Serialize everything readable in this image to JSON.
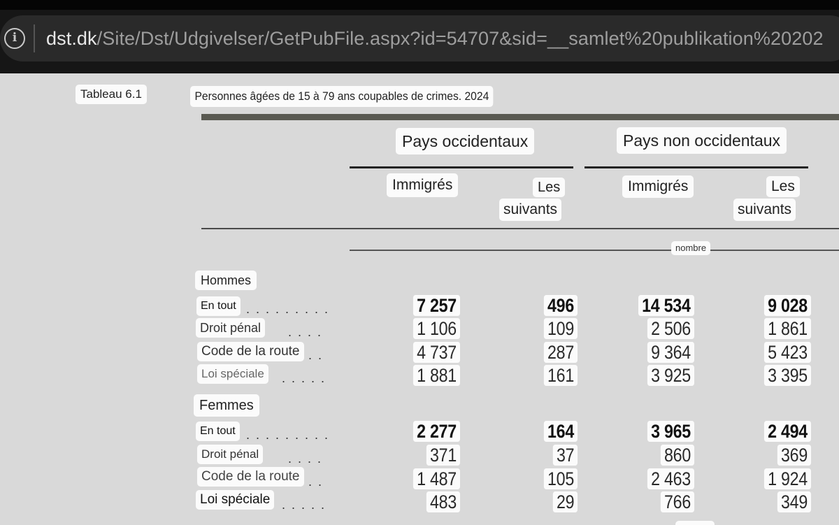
{
  "browser": {
    "url_host": "dst.dk",
    "url_path": "/Site/Dst/Udgivelser/GetPubFile.aspx?id=54707&sid=__samlet%20publikation%20202"
  },
  "table": {
    "label": "Tableau 6.1",
    "title": "Personnes âgées de 15 à 79 ans coupables de crimes. 2024",
    "group_headers": [
      "Pays occidentaux",
      "Pays non occidentaux"
    ],
    "sub_headers": {
      "immigres": "Immigrés",
      "suivants_1": "Les",
      "suivants_2": "suivants"
    },
    "unit": "nombre",
    "sections": [
      {
        "name": "Hommes",
        "rows": [
          {
            "label": "En tout",
            "dots": ". . . . . . . . .",
            "values": [
              "7 257",
              "496",
              "14 534",
              "9 028"
            ],
            "bold": true
          },
          {
            "label": "Droit pénal",
            "dots": ". . . .",
            "values": [
              "1 106",
              "109",
              "2 506",
              "1 861"
            ],
            "bold": false
          },
          {
            "label": "Code de la route",
            "dots": ". .",
            "values": [
              "4 737",
              "287",
              "9 364",
              "5 423"
            ],
            "bold": false
          },
          {
            "label": "Loi spéciale",
            "dots": ". . . . .",
            "values": [
              "1 881",
              "161",
              "3 925",
              "3 395"
            ],
            "bold": false
          }
        ]
      },
      {
        "name": "Femmes",
        "rows": [
          {
            "label": "En tout",
            "dots": ". . . . . . . . .",
            "values": [
              "2 277",
              "164",
              "3 965",
              "2 494"
            ],
            "bold": true
          },
          {
            "label": "Droit pénal",
            "dots": ". . . .",
            "values": [
              "371",
              "37",
              "860",
              "369"
            ],
            "bold": false
          },
          {
            "label": "Code de la route",
            "dots": ". .",
            "values": [
              "1 487",
              "105",
              "2 463",
              "1 924"
            ],
            "bold": false
          },
          {
            "label": "Loi spéciale",
            "dots": ". . . . .",
            "values": [
              "483",
              "29",
              "766",
              "349"
            ],
            "bold": false
          }
        ]
      }
    ]
  }
}
